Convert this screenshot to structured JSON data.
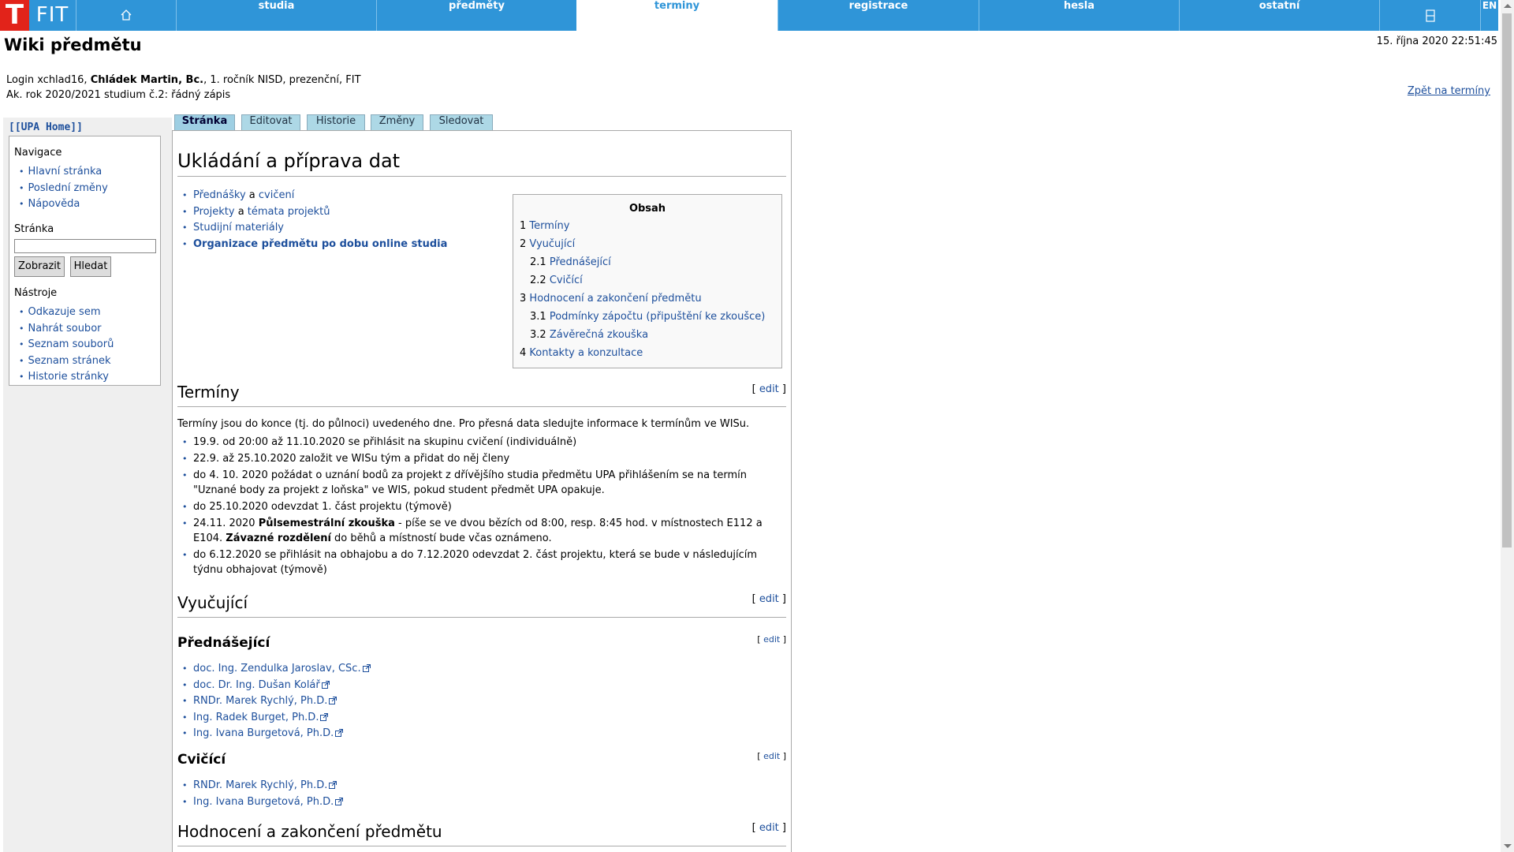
{
  "nav": {
    "logo_t": "T",
    "logo_fit": "FIT",
    "items": [
      "studia",
      "předměty",
      "terminy",
      "registrace",
      "hesla",
      "ostatní"
    ],
    "lang": "EN",
    "home_icon": "home-icon",
    "print_icon": "print-icon"
  },
  "header": {
    "title": "Wiki předmětu",
    "datetime": "15. října 2020 22:51:45",
    "user_line1_a": "Login xchlad16, ",
    "user_line1_name": "Chládek Martin, Bc.",
    "user_line1_b": ", 1. ročník NISD, prezenční, FIT",
    "user_line2": "Ak. rok 2020/2021 studium č.2: řádný zápis",
    "back_link": "Zpět na termíny"
  },
  "sidebar": {
    "home": "[[UPA Home]]",
    "nav_heading": "Navigace",
    "nav_items": [
      "Hlavní stránka",
      "Poslední změny",
      "Nápověda"
    ],
    "page_heading": "Stránka",
    "search_value": "",
    "btn_show": "Zobrazit",
    "btn_search": "Hledat",
    "tools_heading": "Nástroje",
    "tools_items": [
      "Odkazuje sem",
      "Nahrát soubor",
      "Seznam souborů",
      "Seznam stránek",
      "Historie stránky"
    ]
  },
  "tabs": [
    "Stránka",
    "Editovat",
    "Historie",
    "Změny",
    "Sledovat"
  ],
  "content": {
    "title": "Ukládání a příprava dat",
    "intro": [
      {
        "a": "Přednášky",
        "mid": " a ",
        "b": "cvičení"
      },
      {
        "a": "Projekty",
        "mid": " a ",
        "b": "témata projektů"
      },
      {
        "a": "Studijní materiály",
        "mid": "",
        "b": ""
      },
      {
        "a": "Organizace předmětu po dobu online studia",
        "mid": "",
        "b": ""
      }
    ],
    "toc": {
      "title": "Obsah",
      "rows": [
        {
          "num": "1",
          "label": "Termíny"
        },
        {
          "num": "2",
          "label": "Vyučující"
        },
        {
          "num": "2.1",
          "label": "Přednášející"
        },
        {
          "num": "2.2",
          "label": "Cvičící"
        },
        {
          "num": "3",
          "label": "Hodnocení a zakončení předmětu"
        },
        {
          "num": "3.1",
          "label": "Podmínky zápočtu (připuštění ke zkoušce)"
        },
        {
          "num": "3.2",
          "label": "Závěrečná zkouška"
        },
        {
          "num": "4",
          "label": "Kontakty a konzultace"
        }
      ]
    },
    "edit_open": "[ ",
    "edit_label": "edit",
    "edit_close": " ]",
    "terminy": {
      "heading": "Termíny",
      "para": "Termíny jsou do konce (tj. do půlnoci) uvedeného dne. Pro přesná data sledujte informace k termínům ve WISu.",
      "item1": "19.9. od 20:00 až 11.10.2020 se přihlásit na skupinu cvičení (individuálně)",
      "item2": "22.9. až 25.10.2020 založit ve WISu tým a přidat do něj členy",
      "item3": "do 4. 10. 2020 požádat o uznání bodů za projekt z dřívějšího studia předmětu UPA přihlášením se na termín \"Uznané body za projekt z loňska\" ve WIS, pokud student předmět UPA opakuje.",
      "item4": "do 25.10.2020 odevzdat 1. část projektu (týmově)",
      "item5_a": "24.11. 2020 ",
      "item5_b": "Půlsemestrální zkouška",
      "item5_c": " - píše se ve dvou bězích od 8:00, resp. 8:45 hod. v místnostech E112 a E104. ",
      "item5_d": "Závazné rozdělení",
      "item5_e": " do běhů a místností bude včas oznámeno.",
      "item6": "do 6.12.2020 se přihlásit na obhajobu a do 7.12.2020 odevzdat 2. část projektu, která se bude v následujícím týdnu obhajovat (týmově)"
    },
    "vyucujici": {
      "heading": "Vyučující",
      "prednasejici_heading": "Přednášející",
      "prednasejici": [
        "doc. Ing. Zendulka Jaroslav, CSc.",
        "doc. Dr. Ing. Dušan Kolář",
        "RNDr. Marek Rychlý, Ph.D.",
        "Ing. Radek Burget, Ph.D.",
        "Ing. Ivana Burgetová, Ph.D."
      ],
      "cvicici_heading": "Cvičící",
      "cvicici": [
        "RNDr. Marek Rychlý, Ph.D.",
        "Ing. Ivana Burgetová, Ph.D."
      ]
    },
    "hodnoceni": {
      "heading": "Hodnocení a zakončení předmětu"
    }
  },
  "colors": {
    "nav_blue": "#2f95d8",
    "logo_red": "#e2231a",
    "link": "#1d4f9c",
    "tab": "#add8e6",
    "sidebar_bg": "#efefef"
  }
}
